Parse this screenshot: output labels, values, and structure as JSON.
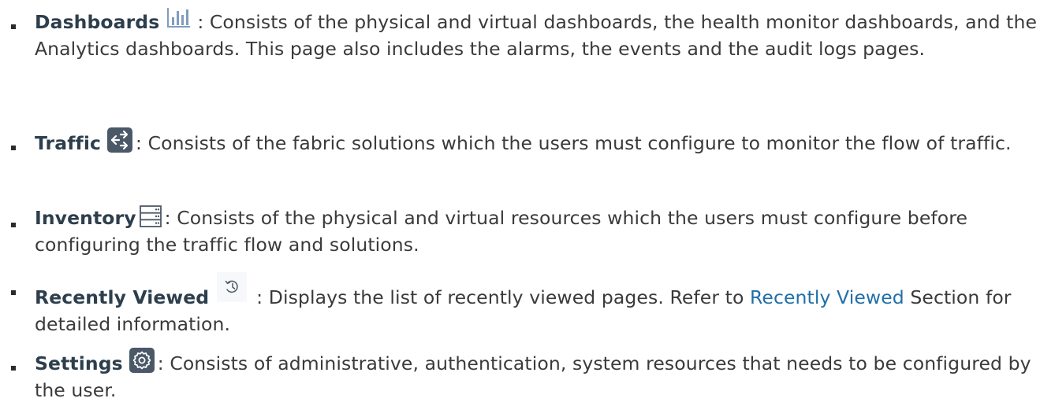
{
  "items": [
    {
      "term": "Dashboards",
      "icon": "bar-chart-icon",
      "description": ": Consists of the physical and virtual dashboards, the health monitor dashboards, and the Analytics dashboards. This page also includes the alarms, the events and the audit logs pages."
    },
    {
      "term": "Traffic",
      "icon": "traffic-flow-icon",
      "description": ": Consists of the fabric solutions which the users must configure to monitor the flow of traffic."
    },
    {
      "term": "Inventory",
      "icon": "server-rack-icon",
      "description": ": Consists of the physical and virtual resources which the users must configure before configuring the traffic flow and solutions."
    },
    {
      "term": "Recently Viewed",
      "icon": "history-icon",
      "description_before": ": Displays the list of recently viewed pages. Refer to ",
      "link": "Recently Viewed",
      "description_after": " Section for detailed information."
    },
    {
      "term": "Settings",
      "icon": "gear-icon",
      "description": ": Consists of administrative, authentication, system resources that needs to be configured by the user."
    }
  ],
  "colors": {
    "text": "#3a3a3a",
    "term": "#2d3e4c",
    "link": "#1f6fa8",
    "icon_dark": "#4a5868",
    "icon_light": "#8aa4c0"
  }
}
